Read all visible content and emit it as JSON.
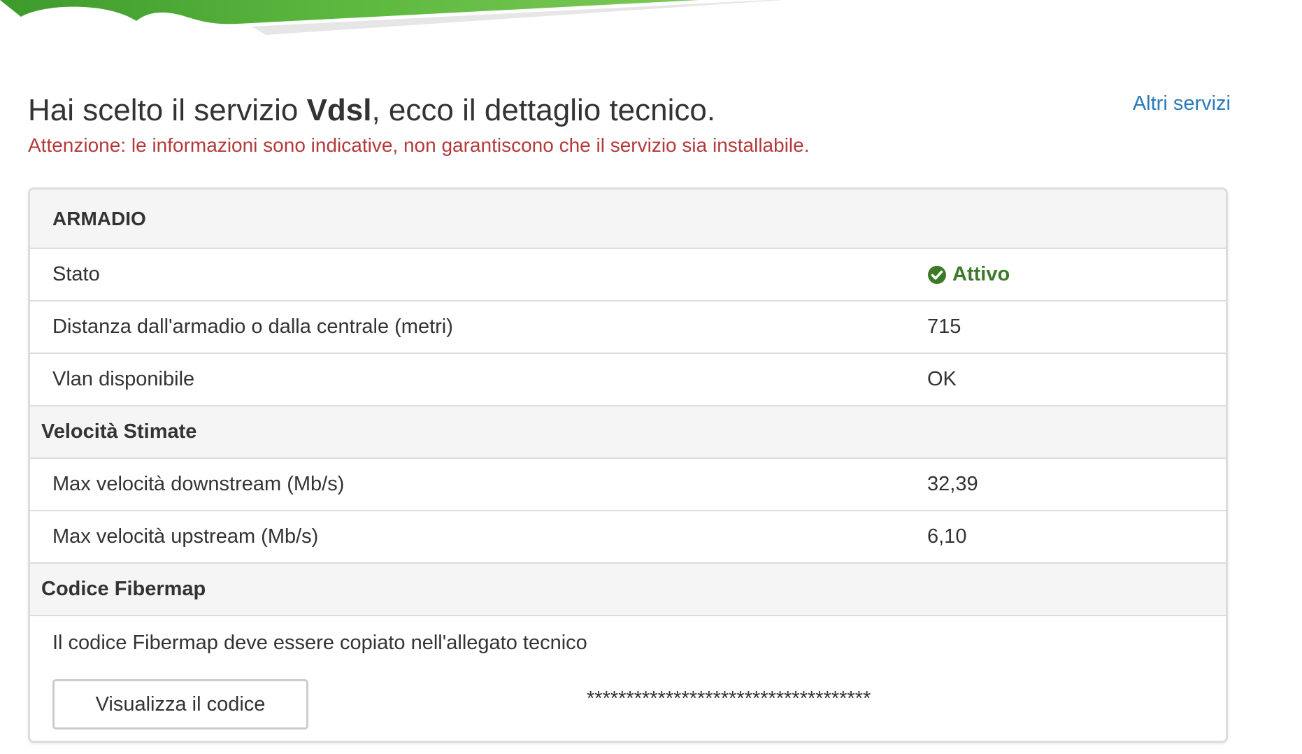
{
  "header": {
    "title_prefix": "Hai scelto il servizio ",
    "service_name": "Vdsl",
    "title_suffix": ", ecco il dettaglio tecnico.",
    "other_services_link": "Altri servizi",
    "warning": "Attenzione: le informazioni sono indicative, non garantiscono che il servizio sia installabile."
  },
  "panel": {
    "heading": "ARMADIO",
    "rows": [
      {
        "label": "Stato",
        "value": "Attivo",
        "status_color": "#3c7a2a",
        "icon": "check-circle-icon"
      },
      {
        "label": "Distanza dall'armadio o dalla centrale (metri)",
        "value": "715"
      },
      {
        "label": "Vlan disponibile",
        "value": "OK"
      }
    ],
    "speed_section": {
      "title": "Velocità Stimate",
      "rows": [
        {
          "label": "Max velocità downstream (Mb/s)",
          "value": "32,39"
        },
        {
          "label": "Max velocità upstream (Mb/s)",
          "value": "6,10"
        }
      ]
    },
    "fibermap_section": {
      "title": "Codice Fibermap",
      "note": "Il codice Fibermap deve essere copiato nell'allegato tecnico",
      "button_label": "Visualizza il codice",
      "masked_code": "************************************"
    }
  },
  "colors": {
    "link": "#2a7ab8",
    "warning": "#b33a3a",
    "banner_green": "#4caf3a"
  }
}
